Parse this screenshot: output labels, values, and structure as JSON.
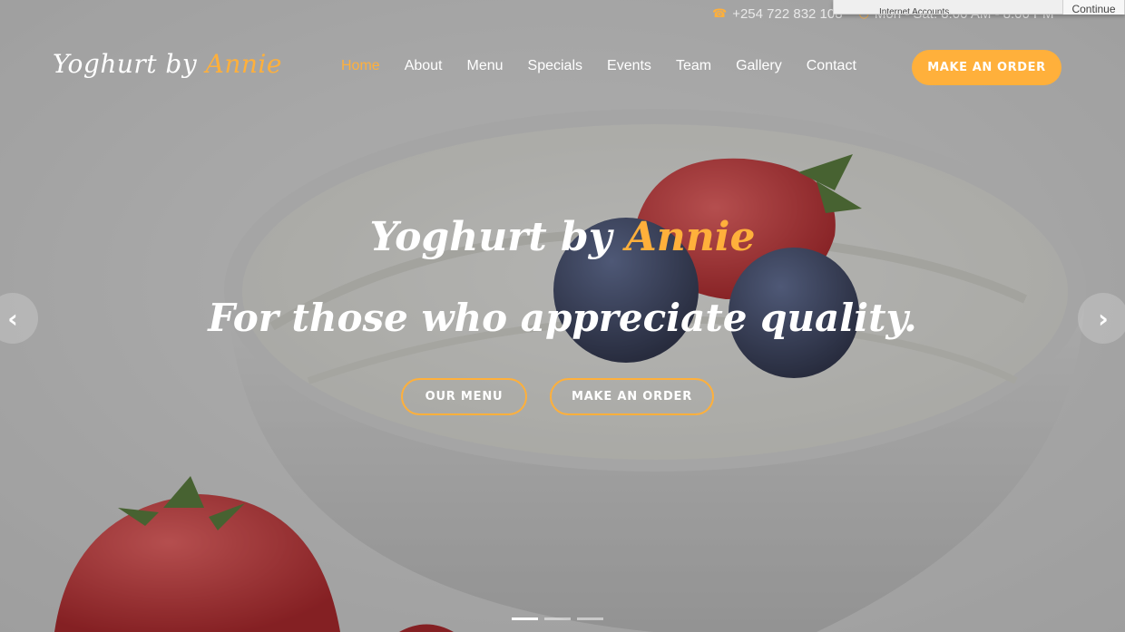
{
  "topbar": {
    "phone": "+254 722 832 108",
    "hours": "Mon - Sat: 8:00 AM - 8:00 PM",
    "phone_icon": "phone-icon",
    "clock_icon": "clock-icon"
  },
  "popup": {
    "text": "Internet Accounts.",
    "button": "Continue"
  },
  "logo": {
    "main": "Yoghurt by",
    "accent": "Annie"
  },
  "nav": {
    "items": [
      "Home",
      "About",
      "Menu",
      "Specials",
      "Events",
      "Team",
      "Gallery",
      "Contact"
    ],
    "active": "Home"
  },
  "header_button": "MAKE AN ORDER",
  "hero": {
    "title_main": "Yoghurt by",
    "title_accent": "Annie",
    "subtitle": "For those who appreciate quality.",
    "btn_menu": "OUR MENU",
    "btn_order": "MAKE AN ORDER",
    "prev_icon": "chevron-left-icon",
    "next_icon": "chevron-right-icon",
    "slide_count": 3,
    "active_slide": 1
  },
  "colors": {
    "accent": "#ffb03b",
    "text": "#ffffff"
  }
}
